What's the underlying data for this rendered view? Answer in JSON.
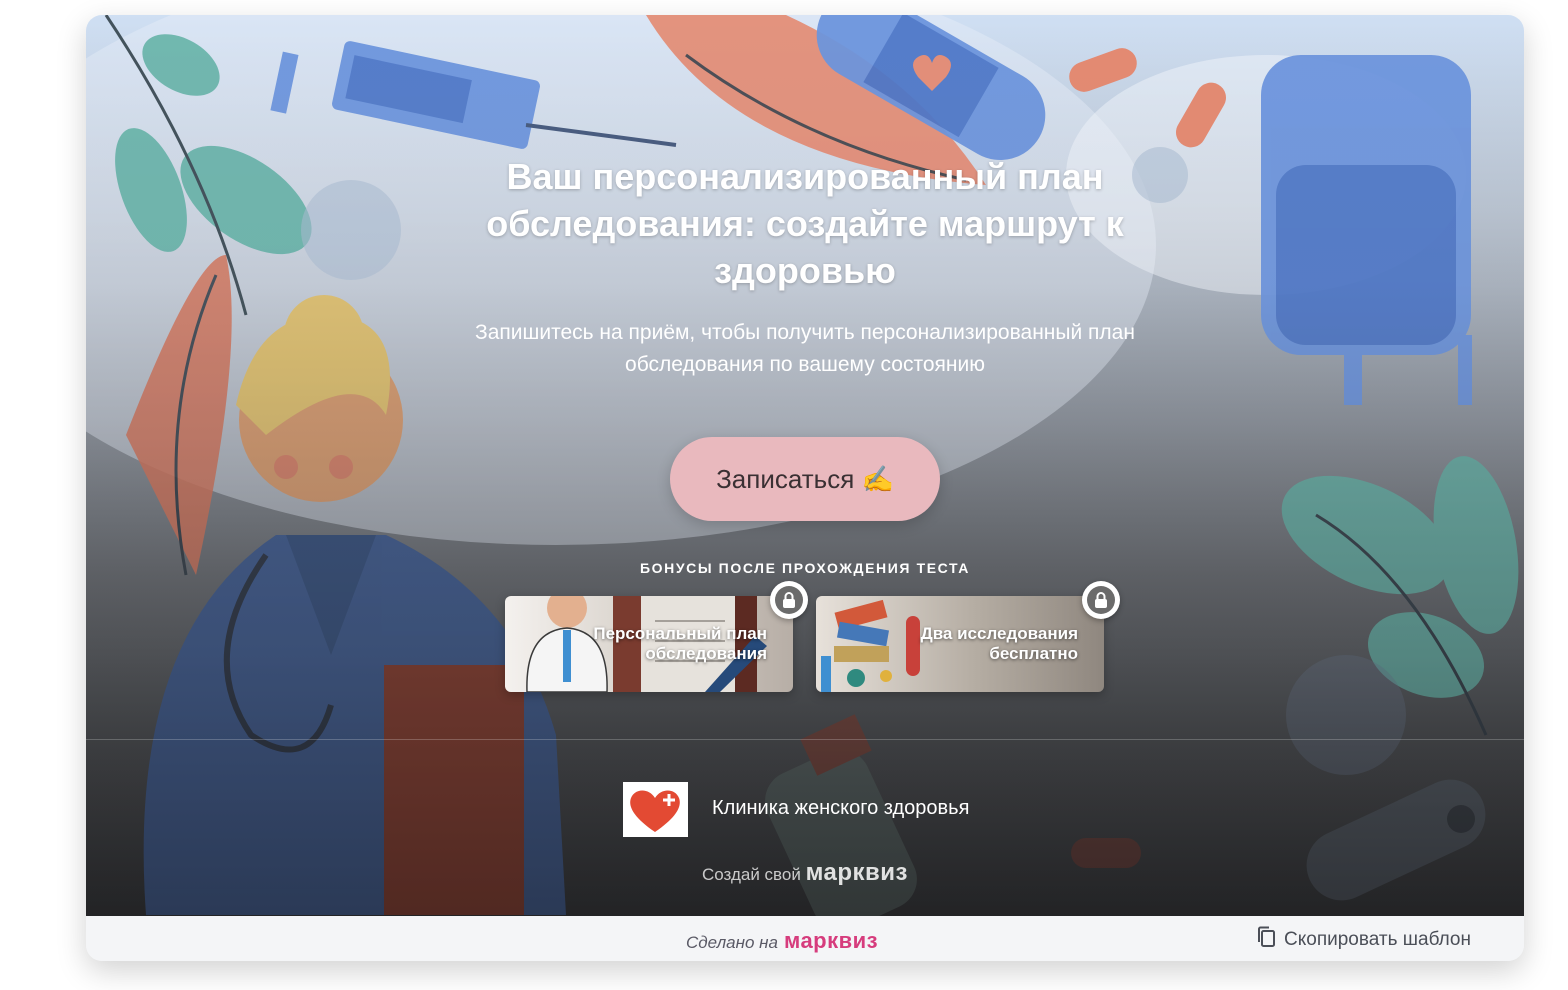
{
  "hero": {
    "title": "Ваш персонализированный план обследования: создайте маршрут к здоровью",
    "subtitle": "Запишитесь на приём, чтобы получить персонализированный план обследования по вашему состоянию",
    "cta_label": "Записаться ✍️"
  },
  "bonuses": {
    "heading": "БОНУСЫ ПОСЛЕ ПРОХОЖДЕНИЯ ТЕСТА",
    "items": [
      {
        "label": "Персональный план обследования",
        "icon": "lock-icon"
      },
      {
        "label": "Два исследования бесплатно",
        "icon": "lock-icon"
      }
    ]
  },
  "company": {
    "name": "Клиника женского здоровья",
    "logo_icon": "heart-plus-icon"
  },
  "branding": {
    "create_own": "Создай свой",
    "brand": "марквиз"
  },
  "footer": {
    "made_on": "Сделано на",
    "brand": "марквиз",
    "copy_template": "Скопировать шаблон",
    "copy_icon": "copy-icon"
  },
  "colors": {
    "cta": "#e9b9be",
    "brand_pink": "#d63c7d"
  }
}
